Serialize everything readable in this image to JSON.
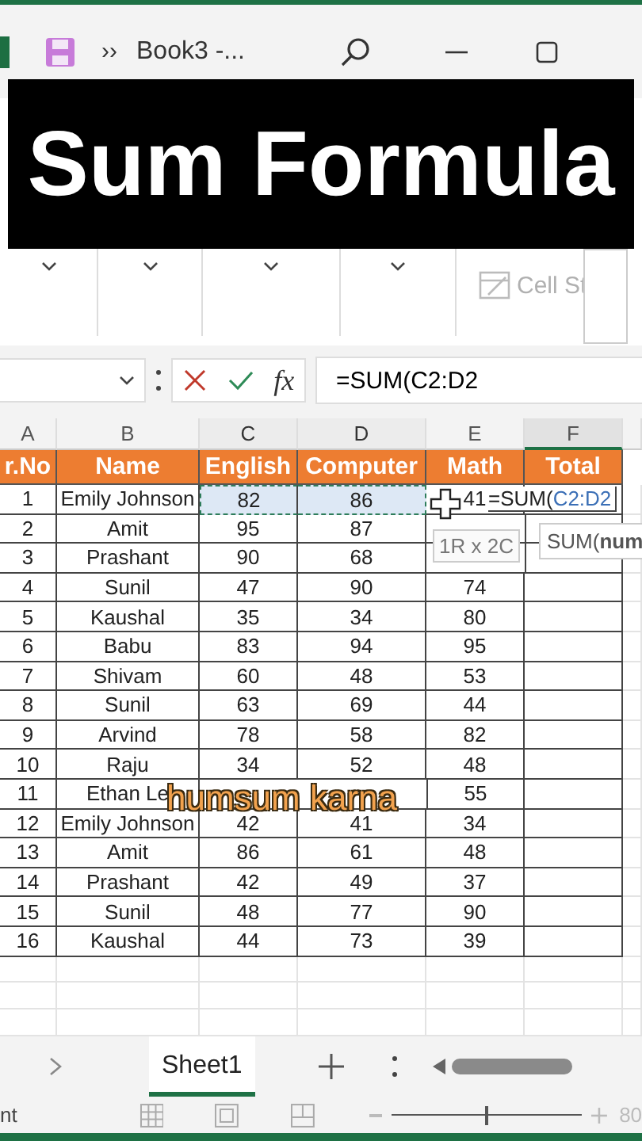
{
  "app": {
    "more_label": "››",
    "title": "Book3 -..."
  },
  "caption": "Sum Formula",
  "ribbon": {
    "cell_styles": "Cell St"
  },
  "formula_bar": {
    "fx_label": "fx",
    "formula": "=SUM(C2:D2"
  },
  "sheet": {
    "columns": [
      {
        "letter": "A",
        "header": "r.No",
        "in_selection": false,
        "selected": false
      },
      {
        "letter": "B",
        "header": "Name",
        "in_selection": false,
        "selected": false
      },
      {
        "letter": "C",
        "header": "English",
        "in_selection": true,
        "selected": false
      },
      {
        "letter": "D",
        "header": "Computer",
        "in_selection": true,
        "selected": false
      },
      {
        "letter": "E",
        "header": "Math",
        "in_selection": false,
        "selected": false
      },
      {
        "letter": "F",
        "header": "Total",
        "in_selection": false,
        "selected": true
      }
    ],
    "rows": [
      {
        "cells": {
          "A": "1",
          "B": "Emily Johnson",
          "C": "82",
          "D": "86",
          "E": "41"
        },
        "in_selection": true,
        "editing": {
          "prefix": "=SUM(",
          "reference": "C2:D2"
        }
      },
      {
        "cells": {
          "A": "2",
          "B": "Amit",
          "C": "95",
          "D": "87"
        },
        "in_selection": false
      },
      {
        "cells": {
          "A": "3",
          "B": "Prashant",
          "C": "90",
          "D": "68"
        },
        "in_selection": false
      },
      {
        "cells": {
          "A": "4",
          "B": "Sunil",
          "C": "47",
          "D": "90",
          "E": "74"
        },
        "in_selection": false
      },
      {
        "cells": {
          "A": "5",
          "B": "Kaushal",
          "C": "35",
          "D": "34",
          "E": "80"
        },
        "in_selection": false
      },
      {
        "cells": {
          "A": "6",
          "B": "Babu",
          "C": "83",
          "D": "94",
          "E": "95"
        },
        "in_selection": false
      },
      {
        "cells": {
          "A": "7",
          "B": "Shivam",
          "C": "60",
          "D": "48",
          "E": "53"
        },
        "in_selection": false
      },
      {
        "cells": {
          "A": "8",
          "B": "Sunil",
          "C": "63",
          "D": "69",
          "E": "44"
        },
        "in_selection": false
      },
      {
        "cells": {
          "A": "9",
          "B": "Arvind",
          "C": "78",
          "D": "58",
          "E": "82"
        },
        "in_selection": false
      },
      {
        "cells": {
          "A": "10",
          "B": "Raju",
          "C": "34",
          "D": "52",
          "E": "48"
        },
        "in_selection": false
      },
      {
        "cells": {
          "A": "11",
          "B": "Ethan Le",
          "E": "55"
        },
        "in_selection": false
      },
      {
        "cells": {
          "A": "12",
          "B": "Emily Johnson",
          "C": "42",
          "D": "41",
          "E": "34"
        },
        "in_selection": false
      },
      {
        "cells": {
          "A": "13",
          "B": "Amit",
          "C": "86",
          "D": "61",
          "E": "48"
        },
        "in_selection": false
      },
      {
        "cells": {
          "A": "14",
          "B": "Prashant",
          "C": "42",
          "D": "49",
          "E": "37"
        },
        "in_selection": false
      },
      {
        "cells": {
          "A": "15",
          "B": "Sunil",
          "C": "48",
          "D": "77",
          "E": "90"
        },
        "in_selection": false
      },
      {
        "cells": {
          "A": "16",
          "B": "Kaushal",
          "C": "44",
          "D": "73",
          "E": "39"
        },
        "in_selection": false
      }
    ],
    "size_tip": "1R x 2C",
    "function_tip": "SUM(**num**"
  },
  "subtitle": "humsum karna",
  "tabs": [
    {
      "label": "Sheet1",
      "selected": true
    }
  ],
  "status": {
    "text": "nt",
    "zoom_slider": {
      "level": 0.5
    },
    "zoom": "80"
  }
}
